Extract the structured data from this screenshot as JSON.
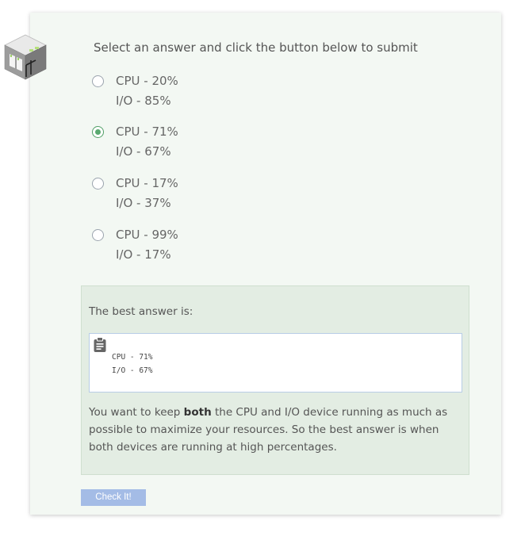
{
  "prompt": "Select an answer and click the button below to submit",
  "options": [
    {
      "line1": "CPU - 20%",
      "line2": "I/O - 85%",
      "selected": false
    },
    {
      "line1": "CPU - 71%",
      "line2": "I/O - 67%",
      "selected": true
    },
    {
      "line1": "CPU - 17%",
      "line2": "I/O - 37%",
      "selected": false
    },
    {
      "line1": "CPU - 99%",
      "line2": "I/O - 17%",
      "selected": false
    }
  ],
  "feedback": {
    "best_label": "The best answer is:",
    "code_line1": "CPU - 71%",
    "code_line2": "I/O - 67%",
    "clipboard_icon": "clipboard-icon",
    "explain_pre": "You want to keep ",
    "explain_bold": "both",
    "explain_post": " the CPU and I/O device running as much as possible to maximize your resources. So the best answer is when both devices are running at high percentages."
  },
  "check_button_label": "Check It!",
  "colors": {
    "card_bg": "#f3f8f3",
    "selected_radio": "#5aa970",
    "feedback_bg": "#e3ede3",
    "button_bg": "#a4bce6"
  }
}
